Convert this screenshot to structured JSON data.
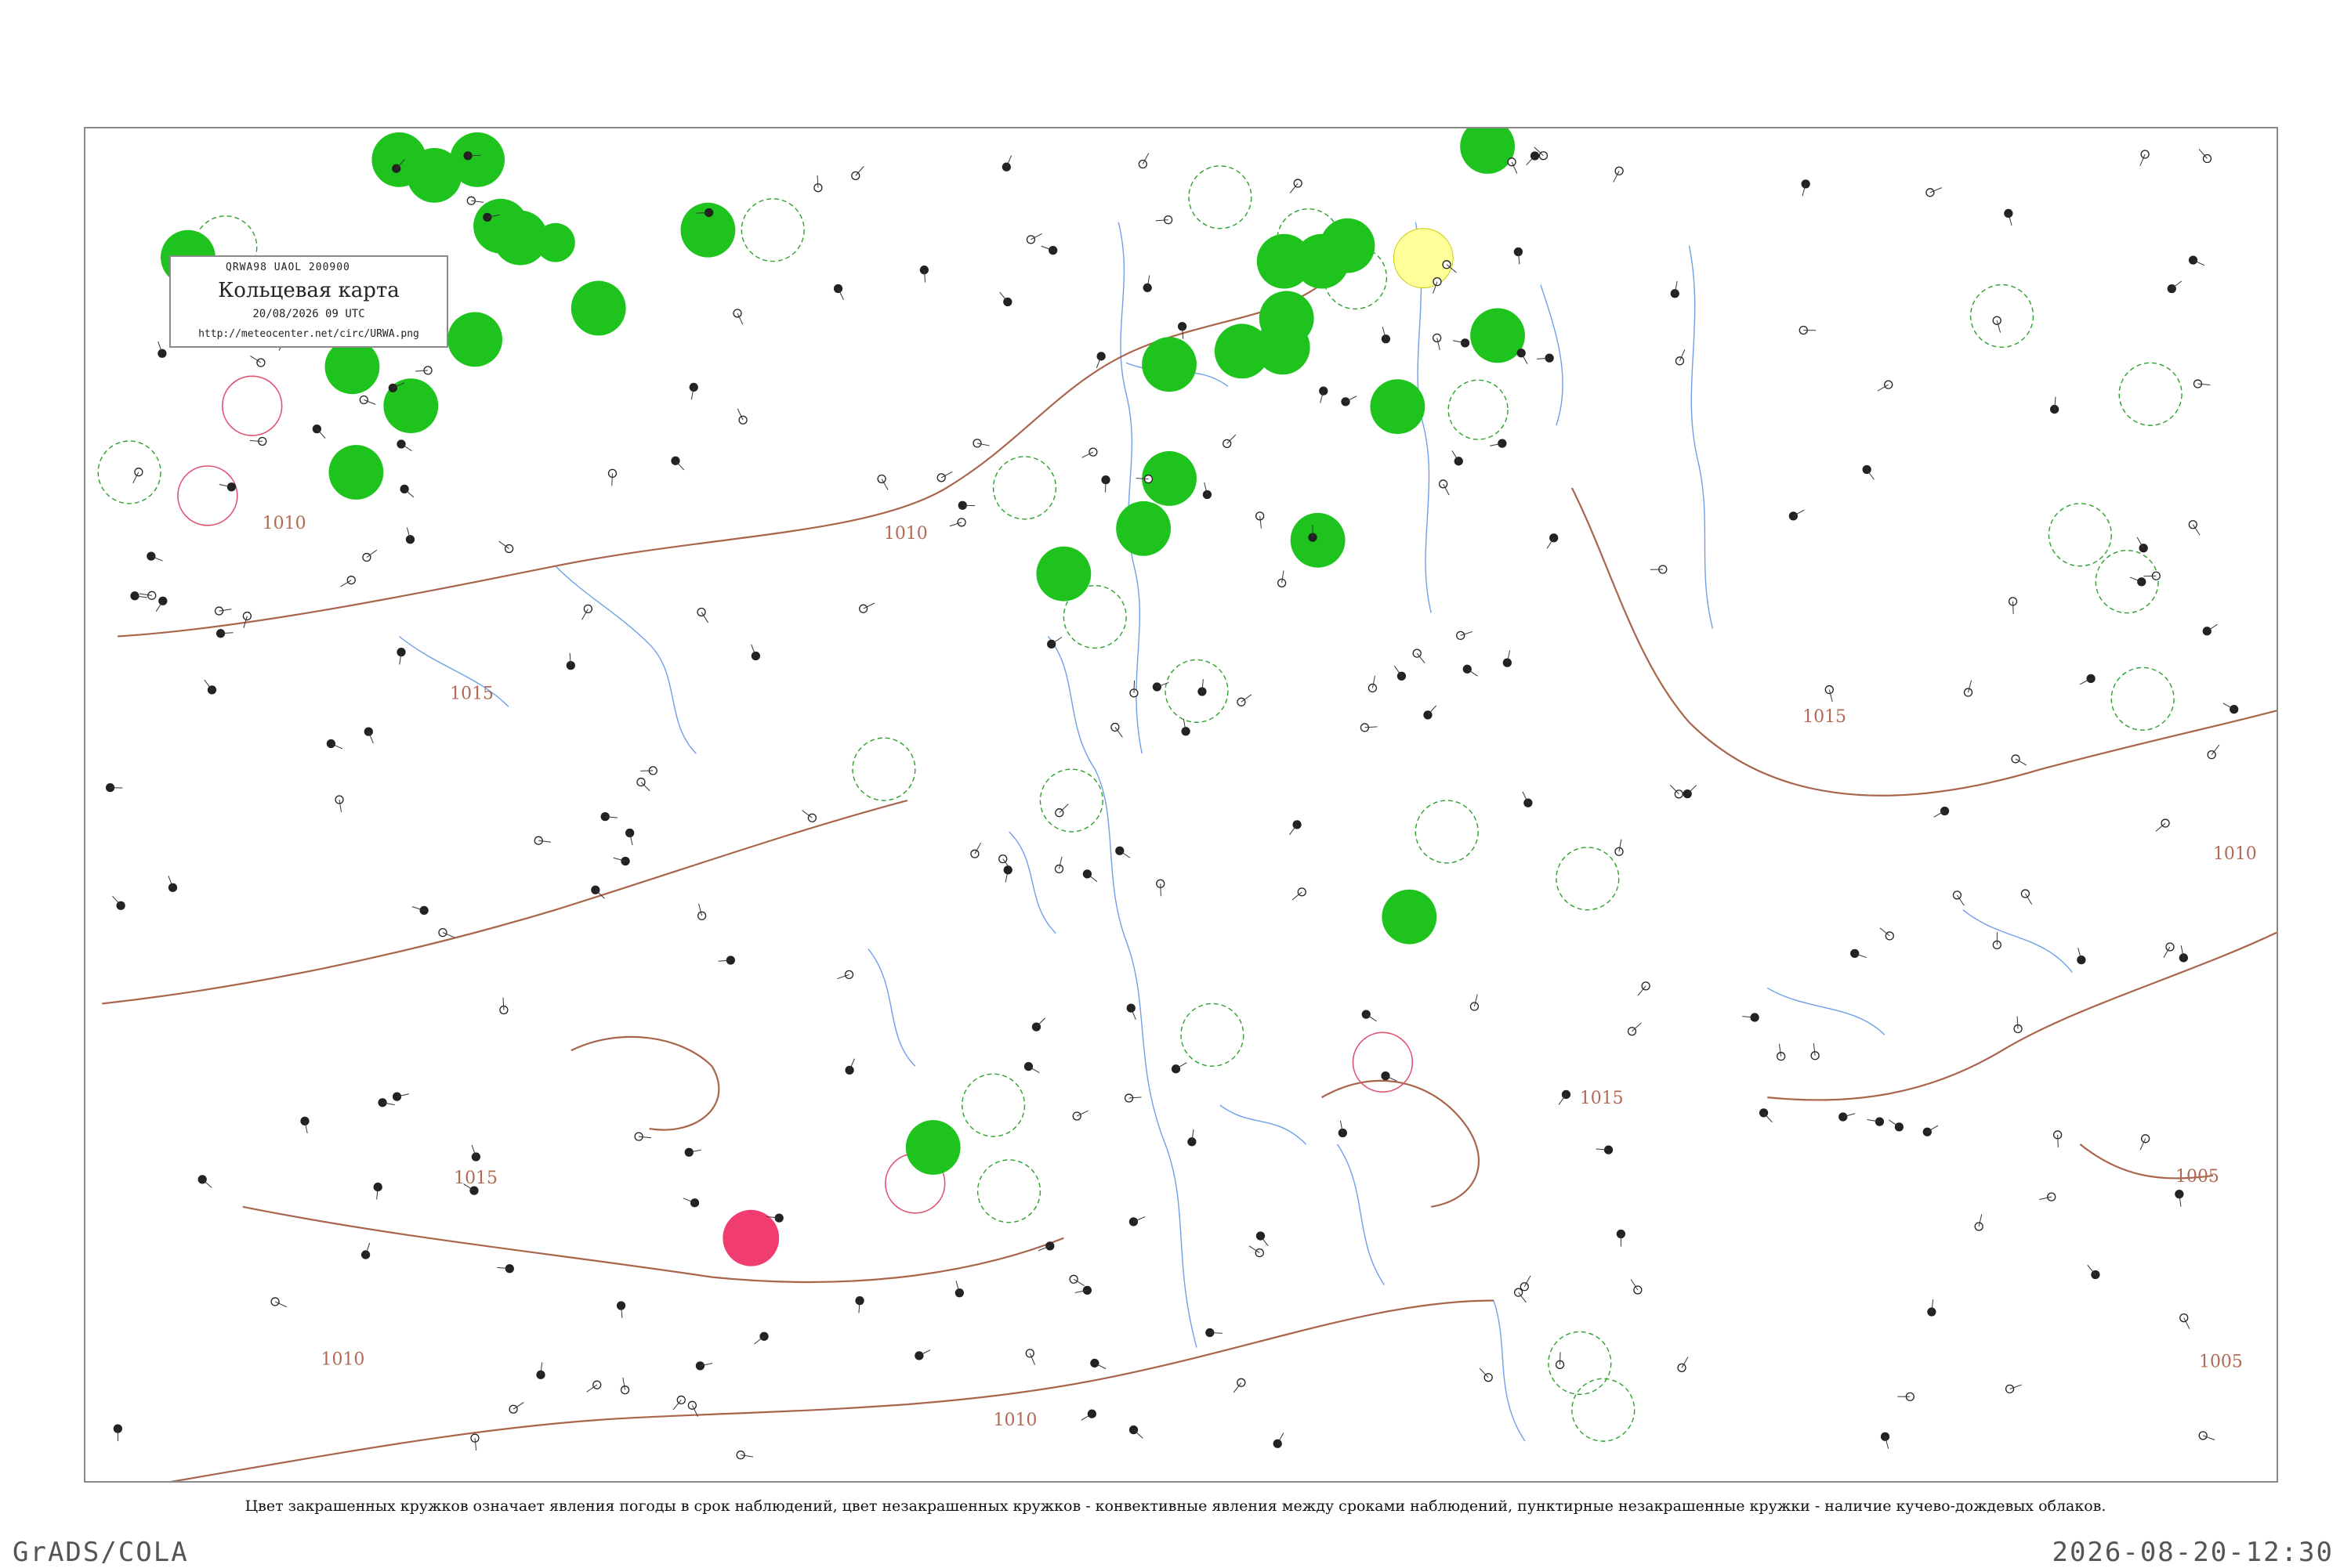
{
  "header": {
    "bulletin": "QRWA98  UAOL  200900",
    "title": "Кольцевая карта",
    "datetime": "20/08/2026 09 UTC",
    "url": "http://meteocenter.net/circ/URWA.png"
  },
  "isobar_labels": [
    "1010",
    "1010",
    "1015",
    "1015",
    "1015",
    "1015",
    "1010",
    "1010",
    "1010",
    "1005",
    "1005"
  ],
  "caption": "Цвет закрашенных кружков означает явления погоды в срок наблюдений, цвет незакрашенных кружков - конвективные явления между сроками наблюдений, пунктирные незакрашенные кружки - наличие кучево-дождевых облаков.",
  "footer": {
    "left": "GrADS/COLA",
    "right": "2026-08-20-12:30"
  },
  "colors": {
    "rain_fill": "#1ec31e",
    "thunder_fill": "#f03c6e",
    "drizzle_fill": "#ffff99",
    "isobar": "#a8654a",
    "river": "#6f9fe8",
    "border": "#8a8a8a"
  },
  "station_circles": {
    "filled_green_count": 30,
    "filled_red_count": 1,
    "filled_yellow_count": 1
  }
}
